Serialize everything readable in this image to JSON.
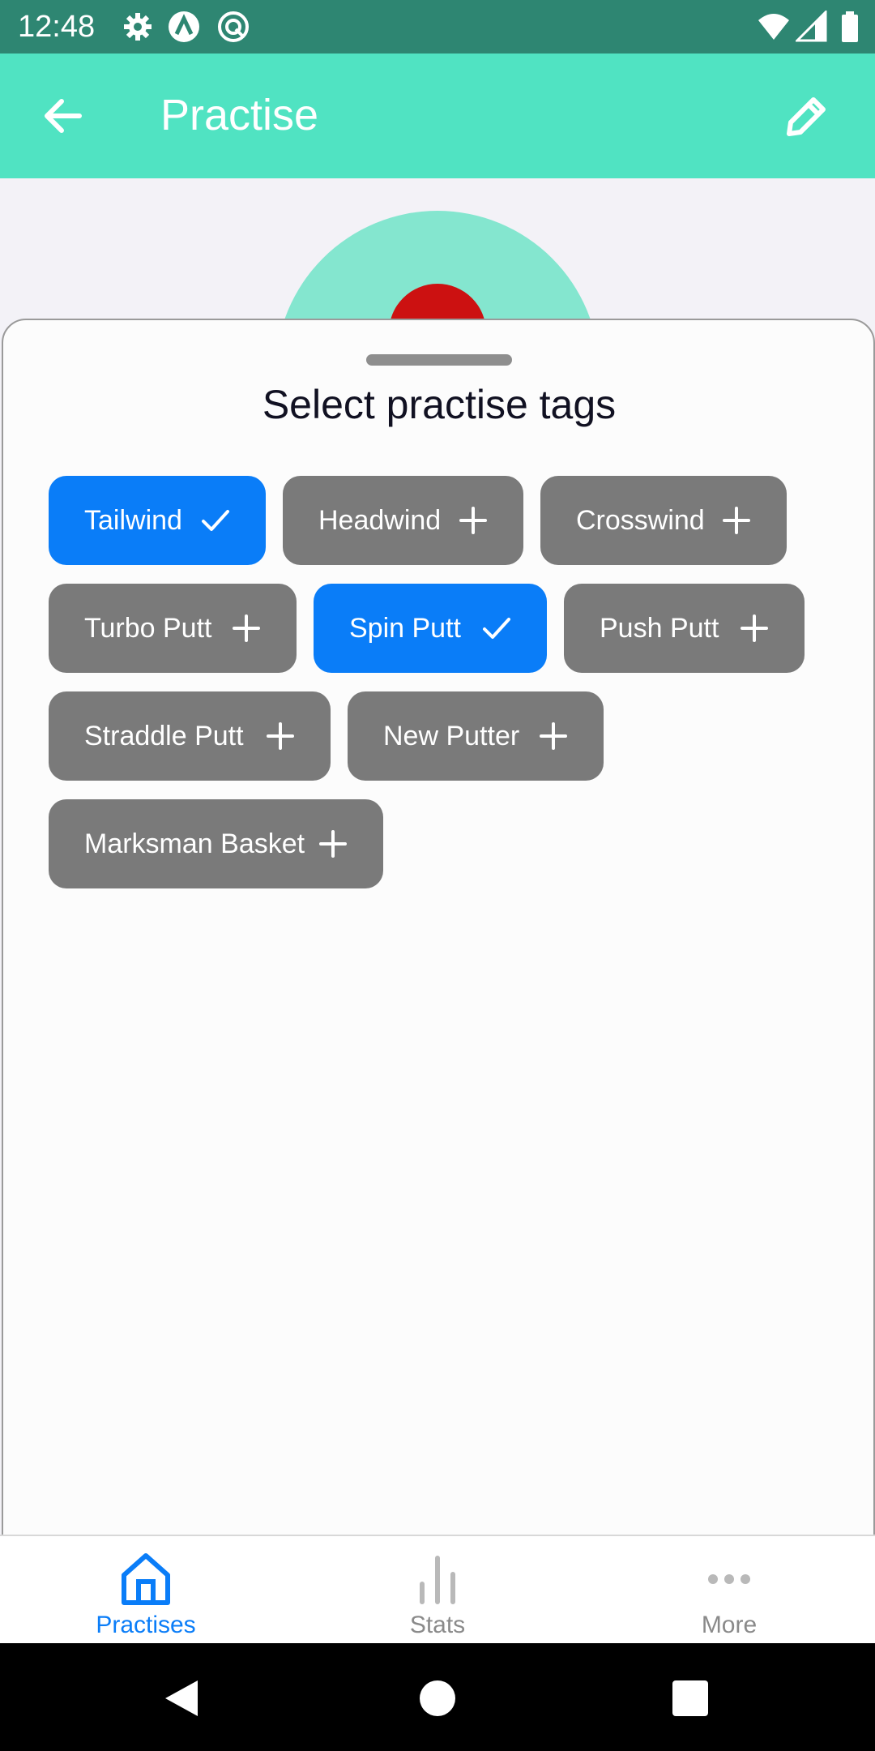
{
  "status_bar": {
    "time": "12:48",
    "icons": [
      "gear-icon",
      "a-circle-icon",
      "q-circle-icon",
      "wifi-icon",
      "signal-icon",
      "battery-icon"
    ]
  },
  "app_bar": {
    "title": "Practise",
    "back_icon": "arrow-left-icon",
    "edit_icon": "pencil-icon"
  },
  "sheet": {
    "title": "Select practise tags",
    "tags": [
      {
        "label": "Tailwind",
        "selected": true
      },
      {
        "label": "Headwind",
        "selected": false
      },
      {
        "label": "Crosswind",
        "selected": false
      },
      {
        "label": "Turbo Putt",
        "selected": false
      },
      {
        "label": "Spin Putt",
        "selected": true
      },
      {
        "label": "Push Putt",
        "selected": false
      },
      {
        "label": "Straddle Putt",
        "selected": false
      },
      {
        "label": "New Putter",
        "selected": false
      },
      {
        "label": "Marksman Basket",
        "selected": false
      }
    ]
  },
  "bottom_nav": {
    "items": [
      {
        "label": "Practises",
        "icon": "home-icon",
        "active": true
      },
      {
        "label": "Stats",
        "icon": "bar-chart-icon",
        "active": false
      },
      {
        "label": "More",
        "icon": "more-dots-icon",
        "active": false
      }
    ]
  },
  "colors": {
    "status_bar": "#2e8672",
    "app_bar": "#50e3c2",
    "chip_selected": "#0a7df8",
    "chip_unselected": "#7a7a7a",
    "nav_active": "#0a7df8",
    "nav_inactive": "#8a8a8a"
  }
}
